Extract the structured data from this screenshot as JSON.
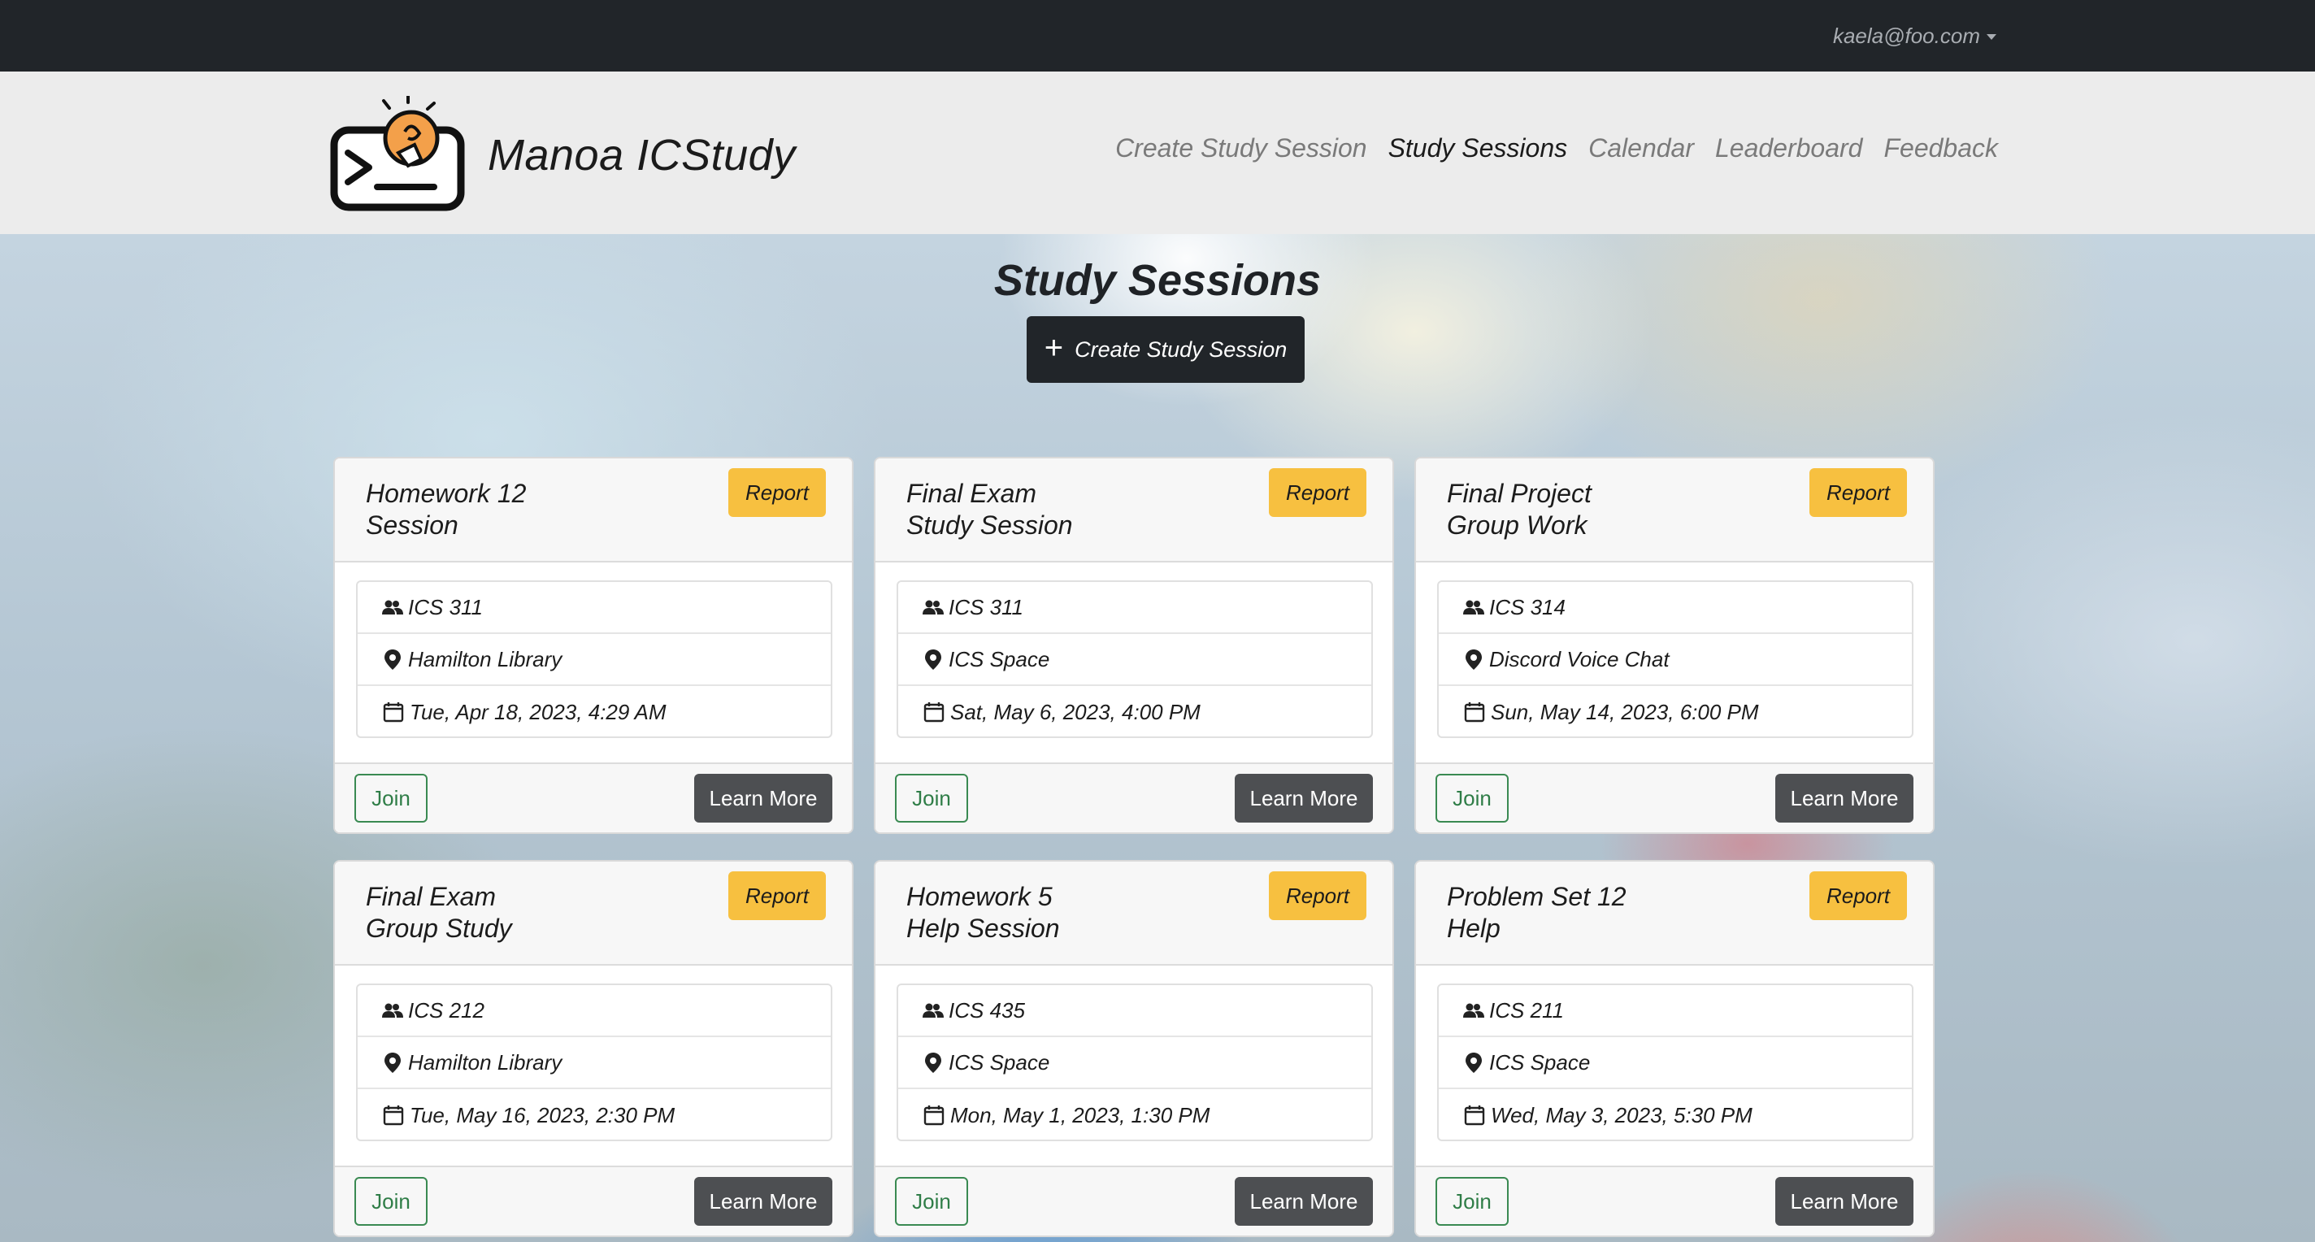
{
  "topbar": {
    "user_email": "kaela@foo.com"
  },
  "header": {
    "brand": "Manoa ICStudy",
    "nav": [
      {
        "label": "Create Study Session",
        "active": false
      },
      {
        "label": "Study Sessions",
        "active": true
      },
      {
        "label": "Calendar",
        "active": false
      },
      {
        "label": "Leaderboard",
        "active": false
      },
      {
        "label": "Feedback",
        "active": false
      }
    ]
  },
  "main": {
    "title": "Study Sessions",
    "create_button": "Create Study Session",
    "sessions": [
      {
        "title": "Homework 12 Session",
        "course": "ICS 311",
        "location": "Hamilton Library",
        "datetime": "Tue, Apr 18, 2023, 4:29 AM",
        "report": "Report",
        "join": "Join",
        "learn_more": "Learn More"
      },
      {
        "title": "Final Exam Study Session",
        "course": "ICS 311",
        "location": "ICS Space",
        "datetime": "Sat, May 6, 2023, 4:00 PM",
        "report": "Report",
        "join": "Join",
        "learn_more": "Learn More"
      },
      {
        "title": "Final Project Group Work",
        "course": "ICS 314",
        "location": "Discord Voice Chat",
        "datetime": "Sun, May 14, 2023, 6:00 PM",
        "report": "Report",
        "join": "Join",
        "learn_more": "Learn More"
      },
      {
        "title": "Final Exam Group Study",
        "course": "ICS 212",
        "location": "Hamilton Library",
        "datetime": "Tue, May 16, 2023, 2:30 PM",
        "report": "Report",
        "join": "Join",
        "learn_more": "Learn More"
      },
      {
        "title": "Homework 5 Help Session",
        "course": "ICS 435",
        "location": "ICS Space",
        "datetime": "Mon, May 1, 2023, 1:30 PM",
        "report": "Report",
        "join": "Join",
        "learn_more": "Learn More"
      },
      {
        "title": "Problem Set 12 Help",
        "course": "ICS 211",
        "location": "ICS Space",
        "datetime": "Wed, May 3, 2023, 5:30 PM",
        "report": "Report",
        "join": "Join",
        "learn_more": "Learn More"
      }
    ]
  },
  "icons": {
    "logo": "lightbulb-terminal-logo",
    "course": "people-icon",
    "location": "map-pin-icon",
    "datetime": "calendar-icon",
    "create": "plus-icon"
  },
  "colors": {
    "topbar": "#212529",
    "report_button": "#f7c040",
    "join_outline": "#3a8a52",
    "learn_more_button": "#4d4f52",
    "create_button": "#212529"
  }
}
